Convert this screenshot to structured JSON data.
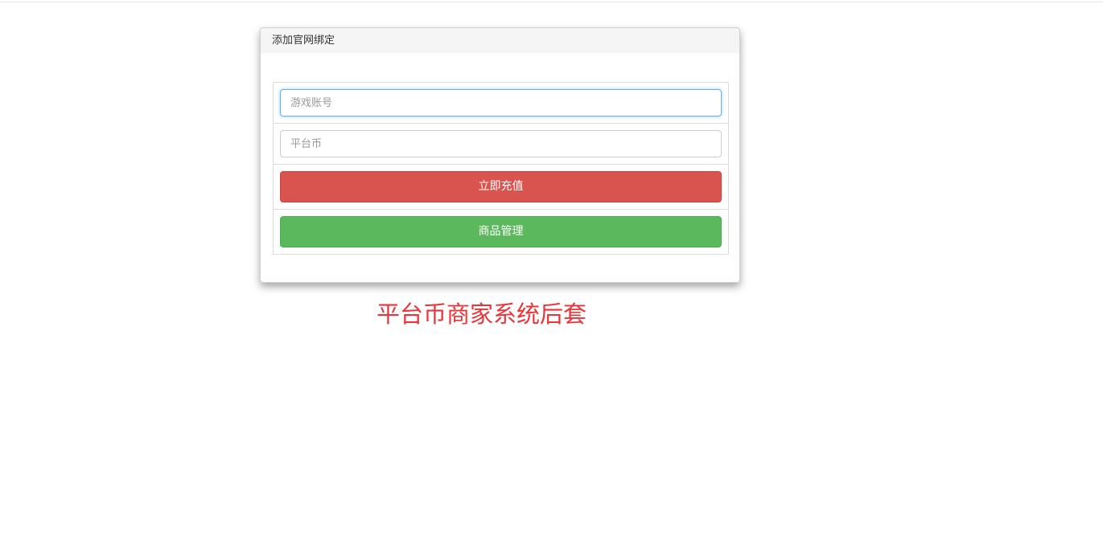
{
  "panel": {
    "title": "添加官网绑定"
  },
  "form": {
    "account_placeholder": "游戏账号",
    "coin_placeholder": "平台币",
    "recharge_label": "立即充值",
    "manage_label": "商品管理"
  },
  "caption": "平台币商家系统后套",
  "colors": {
    "danger": "#d9534f",
    "success": "#5cb85c",
    "caption": "#e8353a",
    "focus": "#66afe9"
  }
}
